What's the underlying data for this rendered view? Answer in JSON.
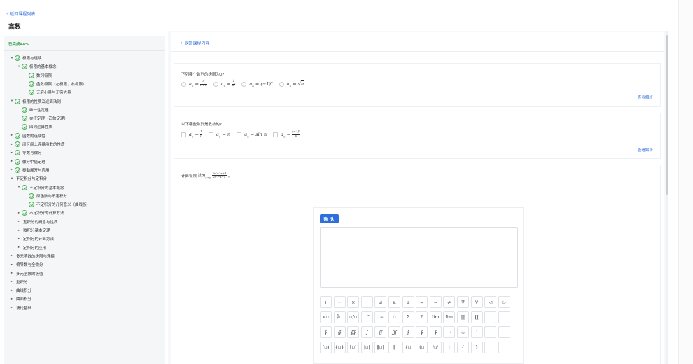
{
  "header": {
    "back_label": "返回课程列表",
    "title": "高数"
  },
  "sidebar": {
    "progress": "已完成44%",
    "tree": [
      {
        "label": "极限与连续",
        "level": 0,
        "arrow": "▾",
        "check": true
      },
      {
        "label": "极限的基本概念",
        "level": 1,
        "arrow": "▾",
        "check": true
      },
      {
        "label": "数列极限",
        "level": 2,
        "arrow": "",
        "check": true
      },
      {
        "label": "函数极限（左极限、右极限）",
        "level": 2,
        "arrow": "",
        "check": true
      },
      {
        "label": "无穷小量与无穷大量",
        "level": 2,
        "arrow": "",
        "check": true
      },
      {
        "label": "极限的性质及运算法则",
        "level": 0,
        "arrow": "▾",
        "check": true
      },
      {
        "label": "唯一性定理",
        "level": 1,
        "arrow": "",
        "check": true
      },
      {
        "label": "夹挤定理（迫敛定理）",
        "level": 1,
        "arrow": "",
        "check": true
      },
      {
        "label": "四则运算性质",
        "level": 1,
        "arrow": "",
        "check": true
      },
      {
        "label": "函数的连续性",
        "level": 0,
        "arrow": "▸",
        "check": true
      },
      {
        "label": "闭区间上连续函数的性质",
        "level": 0,
        "arrow": "▸",
        "check": true
      },
      {
        "label": "导数与微分",
        "level": 0,
        "arrow": "▸",
        "check": true
      },
      {
        "label": "微分中值定理",
        "level": 0,
        "arrow": "▸",
        "check": true
      },
      {
        "label": "泰勒展开与应用",
        "level": 0,
        "arrow": "▸",
        "check": true
      },
      {
        "label": "不定积分与定积分",
        "level": 0,
        "arrow": "▾",
        "check": false
      },
      {
        "label": "不定积分的基本概念",
        "level": 1,
        "arrow": "▾",
        "check": true
      },
      {
        "label": "原函数与不定积分",
        "level": 2,
        "arrow": "",
        "check": true
      },
      {
        "label": "不定积分的几何意义（曲线族）",
        "level": 2,
        "arrow": "",
        "check": true
      },
      {
        "label": "不定积分的计算方法",
        "level": 1,
        "arrow": "▸",
        "check": true
      },
      {
        "label": "定积分的概念与性质",
        "level": 1,
        "arrow": "▸",
        "check": false
      },
      {
        "label": "微积分基本定理",
        "level": 1,
        "arrow": "▸",
        "check": false
      },
      {
        "label": "定积分的计算方法",
        "level": 1,
        "arrow": "▸",
        "check": false
      },
      {
        "label": "定积分的应用",
        "level": 1,
        "arrow": "▸",
        "check": false
      },
      {
        "label": "多元函数的极限与连续",
        "level": 0,
        "arrow": "▸",
        "check": false
      },
      {
        "label": "偏导数与全微分",
        "level": 0,
        "arrow": "▸",
        "check": false
      },
      {
        "label": "多元函数的极值",
        "level": 0,
        "arrow": "▸",
        "check": false
      },
      {
        "label": "重积分",
        "level": 0,
        "arrow": "▸",
        "check": false
      },
      {
        "label": "曲线积分",
        "level": 0,
        "arrow": "▸",
        "check": false
      },
      {
        "label": "曲面积分",
        "level": 0,
        "arrow": "▸",
        "check": false
      },
      {
        "label": "场论基础",
        "level": 0,
        "arrow": "▸",
        "check": false
      }
    ]
  },
  "content": {
    "back_label": "返回课程内容",
    "questions": [
      {
        "prompt": "下列哪个数列的极限为0?",
        "type": "radio",
        "options": [
          "a_n = n/(n+1)",
          "a_n = 1/n²",
          "a_n = (−1)ⁿ",
          "a_n = √n"
        ],
        "analysis": "查看解析"
      },
      {
        "prompt": "以下哪些数列是收敛的?",
        "type": "checkbox",
        "options": [
          "a_n = 1/n",
          "a_n = n",
          "a_n = sin n",
          "a_n = (−1)ⁿ/n"
        ],
        "analysis": "查看解析"
      },
      {
        "prompt": "计算极限",
        "formula": "lim x→∞ (3x²−2x+1)/(2x²−x+5)",
        "suffix": "。"
      }
    ]
  },
  "editor": {
    "confirm_label": "确 认",
    "keys": [
      [
        "+",
        "−",
        "×",
        "÷",
        "≤",
        "≥",
        "±",
        "≈",
        "~",
        "≠",
        "∇",
        "∀",
        "◁",
        "▷"
      ],
      [
        "√▫",
        "∛▫",
        "▫/▫",
        "▫°",
        "▫₀",
        "▫̇",
        "Σ",
        "Σ",
        "lim",
        "lim",
        "∏",
        "∐",
        "",
        ""
      ],
      [
        "∮",
        "∯",
        "∰",
        "∫",
        "∬",
        "∭",
        "∱",
        "∲",
        "∳",
        "→",
        "∞",
        "′",
        "",
        ""
      ],
      [
        "(▫)",
        "{▫}",
        "[▫]",
        "|▫|",
        "‖▫‖",
        "‖",
        "{▫",
        "(▫",
        "⁽▫⁾",
        "|",
        "{",
        "}",
        "",
        ""
      ]
    ]
  }
}
